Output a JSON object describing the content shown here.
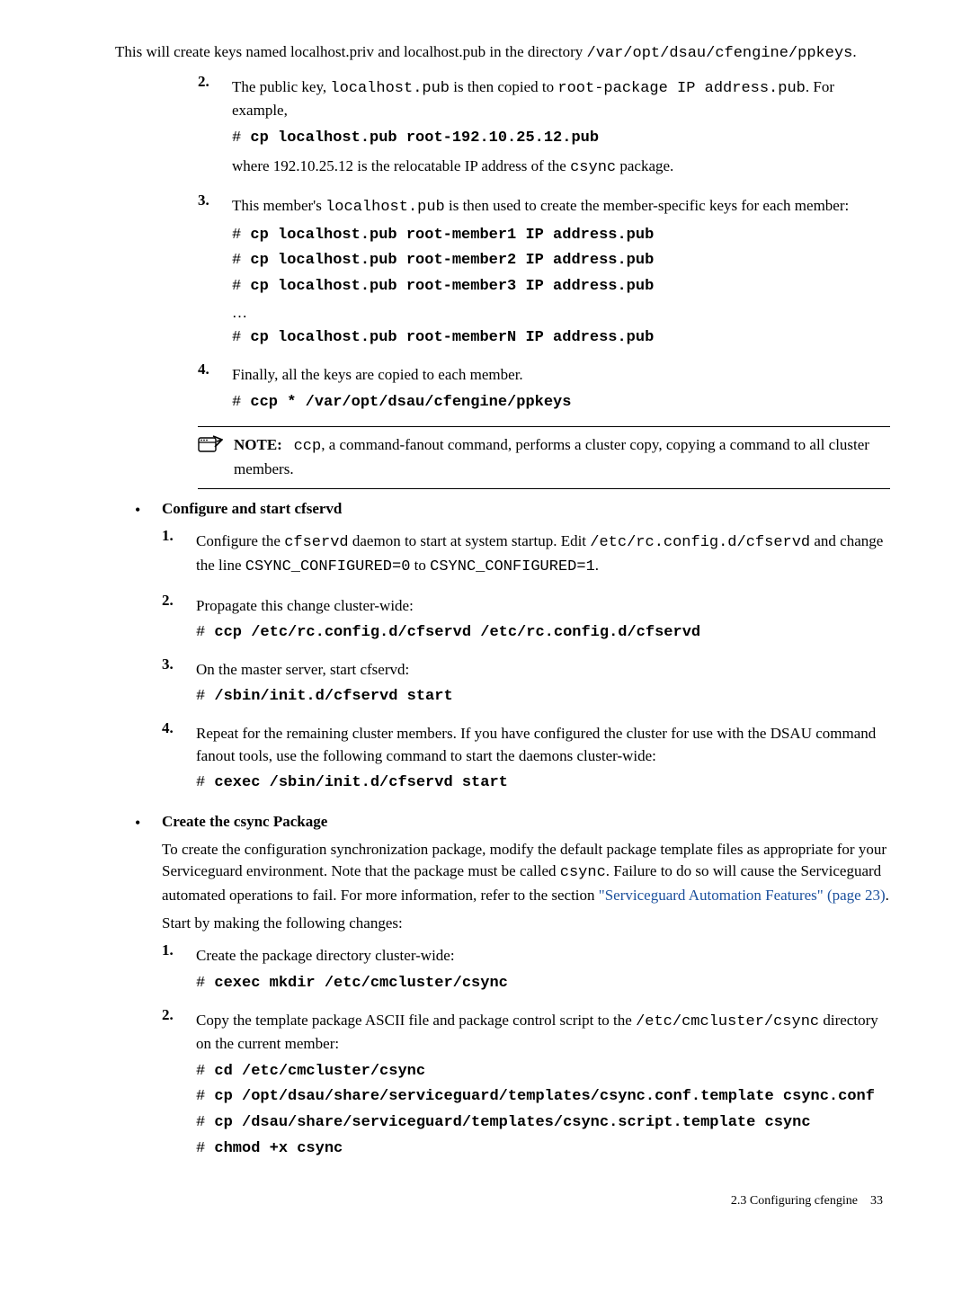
{
  "intro": {
    "p1a": "This will create keys named localhost.priv and localhost.pub in the directory ",
    "p1b": "/var/opt/dsau/cfengine/ppkeys",
    "p1c": "."
  },
  "step2": {
    "num": "2.",
    "t1": "The public key, ",
    "t2": "localhost.pub",
    "t3": " is then copied to ",
    "t4": "root-package IP address.pub",
    "t5": ". For example,",
    "hash": "# ",
    "cmd": "cp localhost.pub root-192.10.25.12.pub",
    "w1": "where 192.10.25.12 is the relocatable IP address of the ",
    "w2": "csync",
    "w3": " package."
  },
  "step3": {
    "num": "3.",
    "t1": "This member's ",
    "t2": "localhost.pub",
    "t3": " is then used to create the member-specific keys for each member:",
    "hash": "# ",
    "c1": "cp localhost.pub root-member1 IP address.pub",
    "c2": "cp localhost.pub root-member2 IP address.pub",
    "c3": "cp localhost.pub root-member3 IP address.pub",
    "dots": "…",
    "cN": "cp localhost.pub root-memberN IP address.pub"
  },
  "step4": {
    "num": "4.",
    "t1": "Finally, all the keys are copied to each member.",
    "hash": "# ",
    "cmd": "ccp * /var/opt/dsau/cfengine/ppkeys"
  },
  "note1": {
    "label": "NOTE:",
    "t1": "ccp",
    "t2": ", a command-fanout command, performs a cluster copy, copying a command to all cluster members."
  },
  "bulletA": {
    "heading": "Configure and start cfservd",
    "s1": {
      "num": "1.",
      "a": "Configure the ",
      "b": "cfservd",
      "c": " daemon to start at system startup. Edit ",
      "d": "/etc/rc.config.d/cfservd",
      "e": " and change the line ",
      "f": "CSYNC_CONFIGURED=0",
      "g": " to  ",
      "h": "CSYNC_CONFIGURED=1",
      "i": "."
    },
    "s2": {
      "num": "2.",
      "a": "Propagate this change cluster-wide:",
      "hash": "# ",
      "cmd": "ccp /etc/rc.config.d/cfservd /etc/rc.config.d/cfservd"
    },
    "s3": {
      "num": "3.",
      "a": "On the master server, start cfservd:",
      "hash": "# ",
      "cmd": "/sbin/init.d/cfservd start"
    },
    "s4": {
      "num": "4.",
      "a": "Repeat for the remaining cluster members. If you have configured the cluster for use with the DSAU command fanout tools, use the following command to start the daemons cluster-wide:",
      "hash": "# ",
      "cmd": "cexec /sbin/init.d/cfservd start"
    }
  },
  "bulletB": {
    "heading": "Create the csync Package",
    "p1a": "To create the configuration  synchronization package, modify the default package template files as appropriate for your Serviceguard environment. Note that the package must be called ",
    "p1b": "csync",
    "p1c": ". Failure to do so will cause the Serviceguard automated operations to fail. For more information, refer to the section ",
    "link": "\"Serviceguard Automation Features\" (page 23)",
    "p1d": ".",
    "p2": "Start by making the following changes:",
    "s1": {
      "num": "1.",
      "a": "Create the package directory cluster-wide:",
      "hash": "# ",
      "cmd": "cexec mkdir /etc/cmcluster/csync"
    },
    "s2": {
      "num": "2.",
      "a": "Copy the template package ASCII file and package control script to the ",
      "b": "/etc/cmcluster/csync",
      "c": " directory on the current member:",
      "hash": "# ",
      "c1": "cd /etc/cmcluster/csync",
      "c2": "cp /opt/dsau/share/serviceguard/templates/csync.conf.template csync.conf",
      "c3": "cp /dsau/share/serviceguard/templates/csync.script.template csync",
      "c4": "chmod +x csync"
    }
  },
  "footer": {
    "section": "2.3 Configuring cfengine",
    "page": "33"
  }
}
